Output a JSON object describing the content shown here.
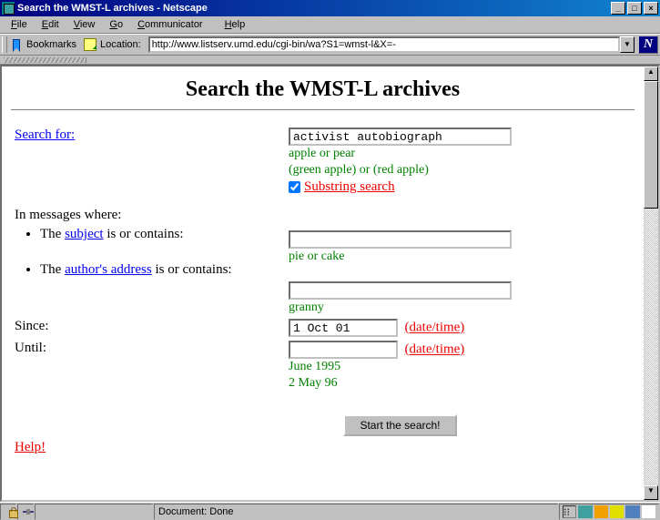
{
  "window": {
    "title": "Search the WMST-L archives - Netscape"
  },
  "menubar": {
    "items": [
      "File",
      "Edit",
      "View",
      "Go",
      "Communicator",
      "Help"
    ]
  },
  "toolbar": {
    "bookmarks_label": "Bookmarks",
    "location_label": "Location:",
    "location_value": "http://www.listserv.umd.edu/cgi-bin/wa?S1=wmst-l&X=-"
  },
  "page": {
    "heading": "Search the WMST-L archives",
    "search_for_label": "Search for:",
    "search_for_value": "activist autobiograph",
    "search_hint1": "apple or pear",
    "search_hint2": "(green apple) or (red apple)",
    "substring_checked": true,
    "substring_label": "Substring search",
    "inmsg_label": "In messages where:",
    "subject_prefix": "The ",
    "subject_link": "subject",
    "subject_suffix": " is or contains:",
    "subject_value": "",
    "subject_hint": "pie or cake",
    "author_prefix": "The ",
    "author_link": "author's address",
    "author_suffix": " is or contains:",
    "author_value": "",
    "author_hint": "granny",
    "since_label": "Since:",
    "since_value": "1 Oct 01",
    "until_label": "Until:",
    "until_value": "",
    "datetime_label": "(date/time)",
    "date_hint1": "June 1995",
    "date_hint2": "2 May 96",
    "start_button": "Start the search!",
    "help_label": "Help!"
  },
  "status": {
    "message": "Document: Done"
  }
}
